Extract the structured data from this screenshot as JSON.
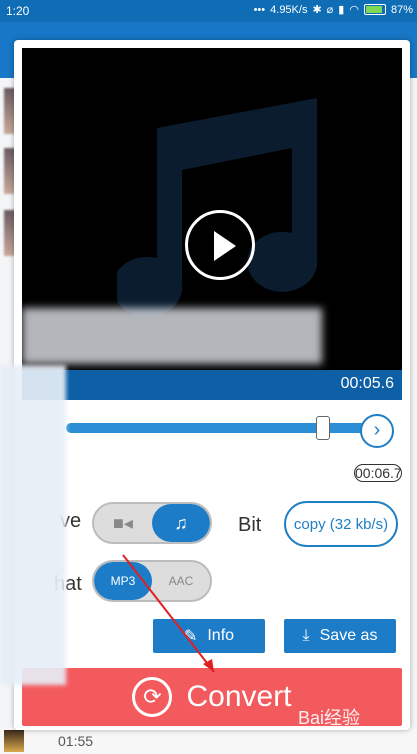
{
  "status_bar": {
    "time": "1:20",
    "network_speed": "4.95K/s",
    "battery": "87"
  },
  "player": {
    "current_time": "00:05.6",
    "end_time": "00:06.7"
  },
  "options": {
    "save_label_partial": "ve",
    "format_label_partial": "hat",
    "bit_label": "Bit",
    "bitrate_value": "copy (32 kb/s)",
    "format_options": [
      "MP3",
      "AAC"
    ]
  },
  "actions": {
    "info_label": "Info",
    "save_as_label": "Save as",
    "convert_label": "Convert"
  },
  "background_list": {
    "bottom_time": "01:55"
  },
  "watermark": "Bai经验",
  "colors": {
    "accent": "#1d7cc8",
    "convert": "#f35a5e",
    "status_bar": "#0f6db5"
  }
}
